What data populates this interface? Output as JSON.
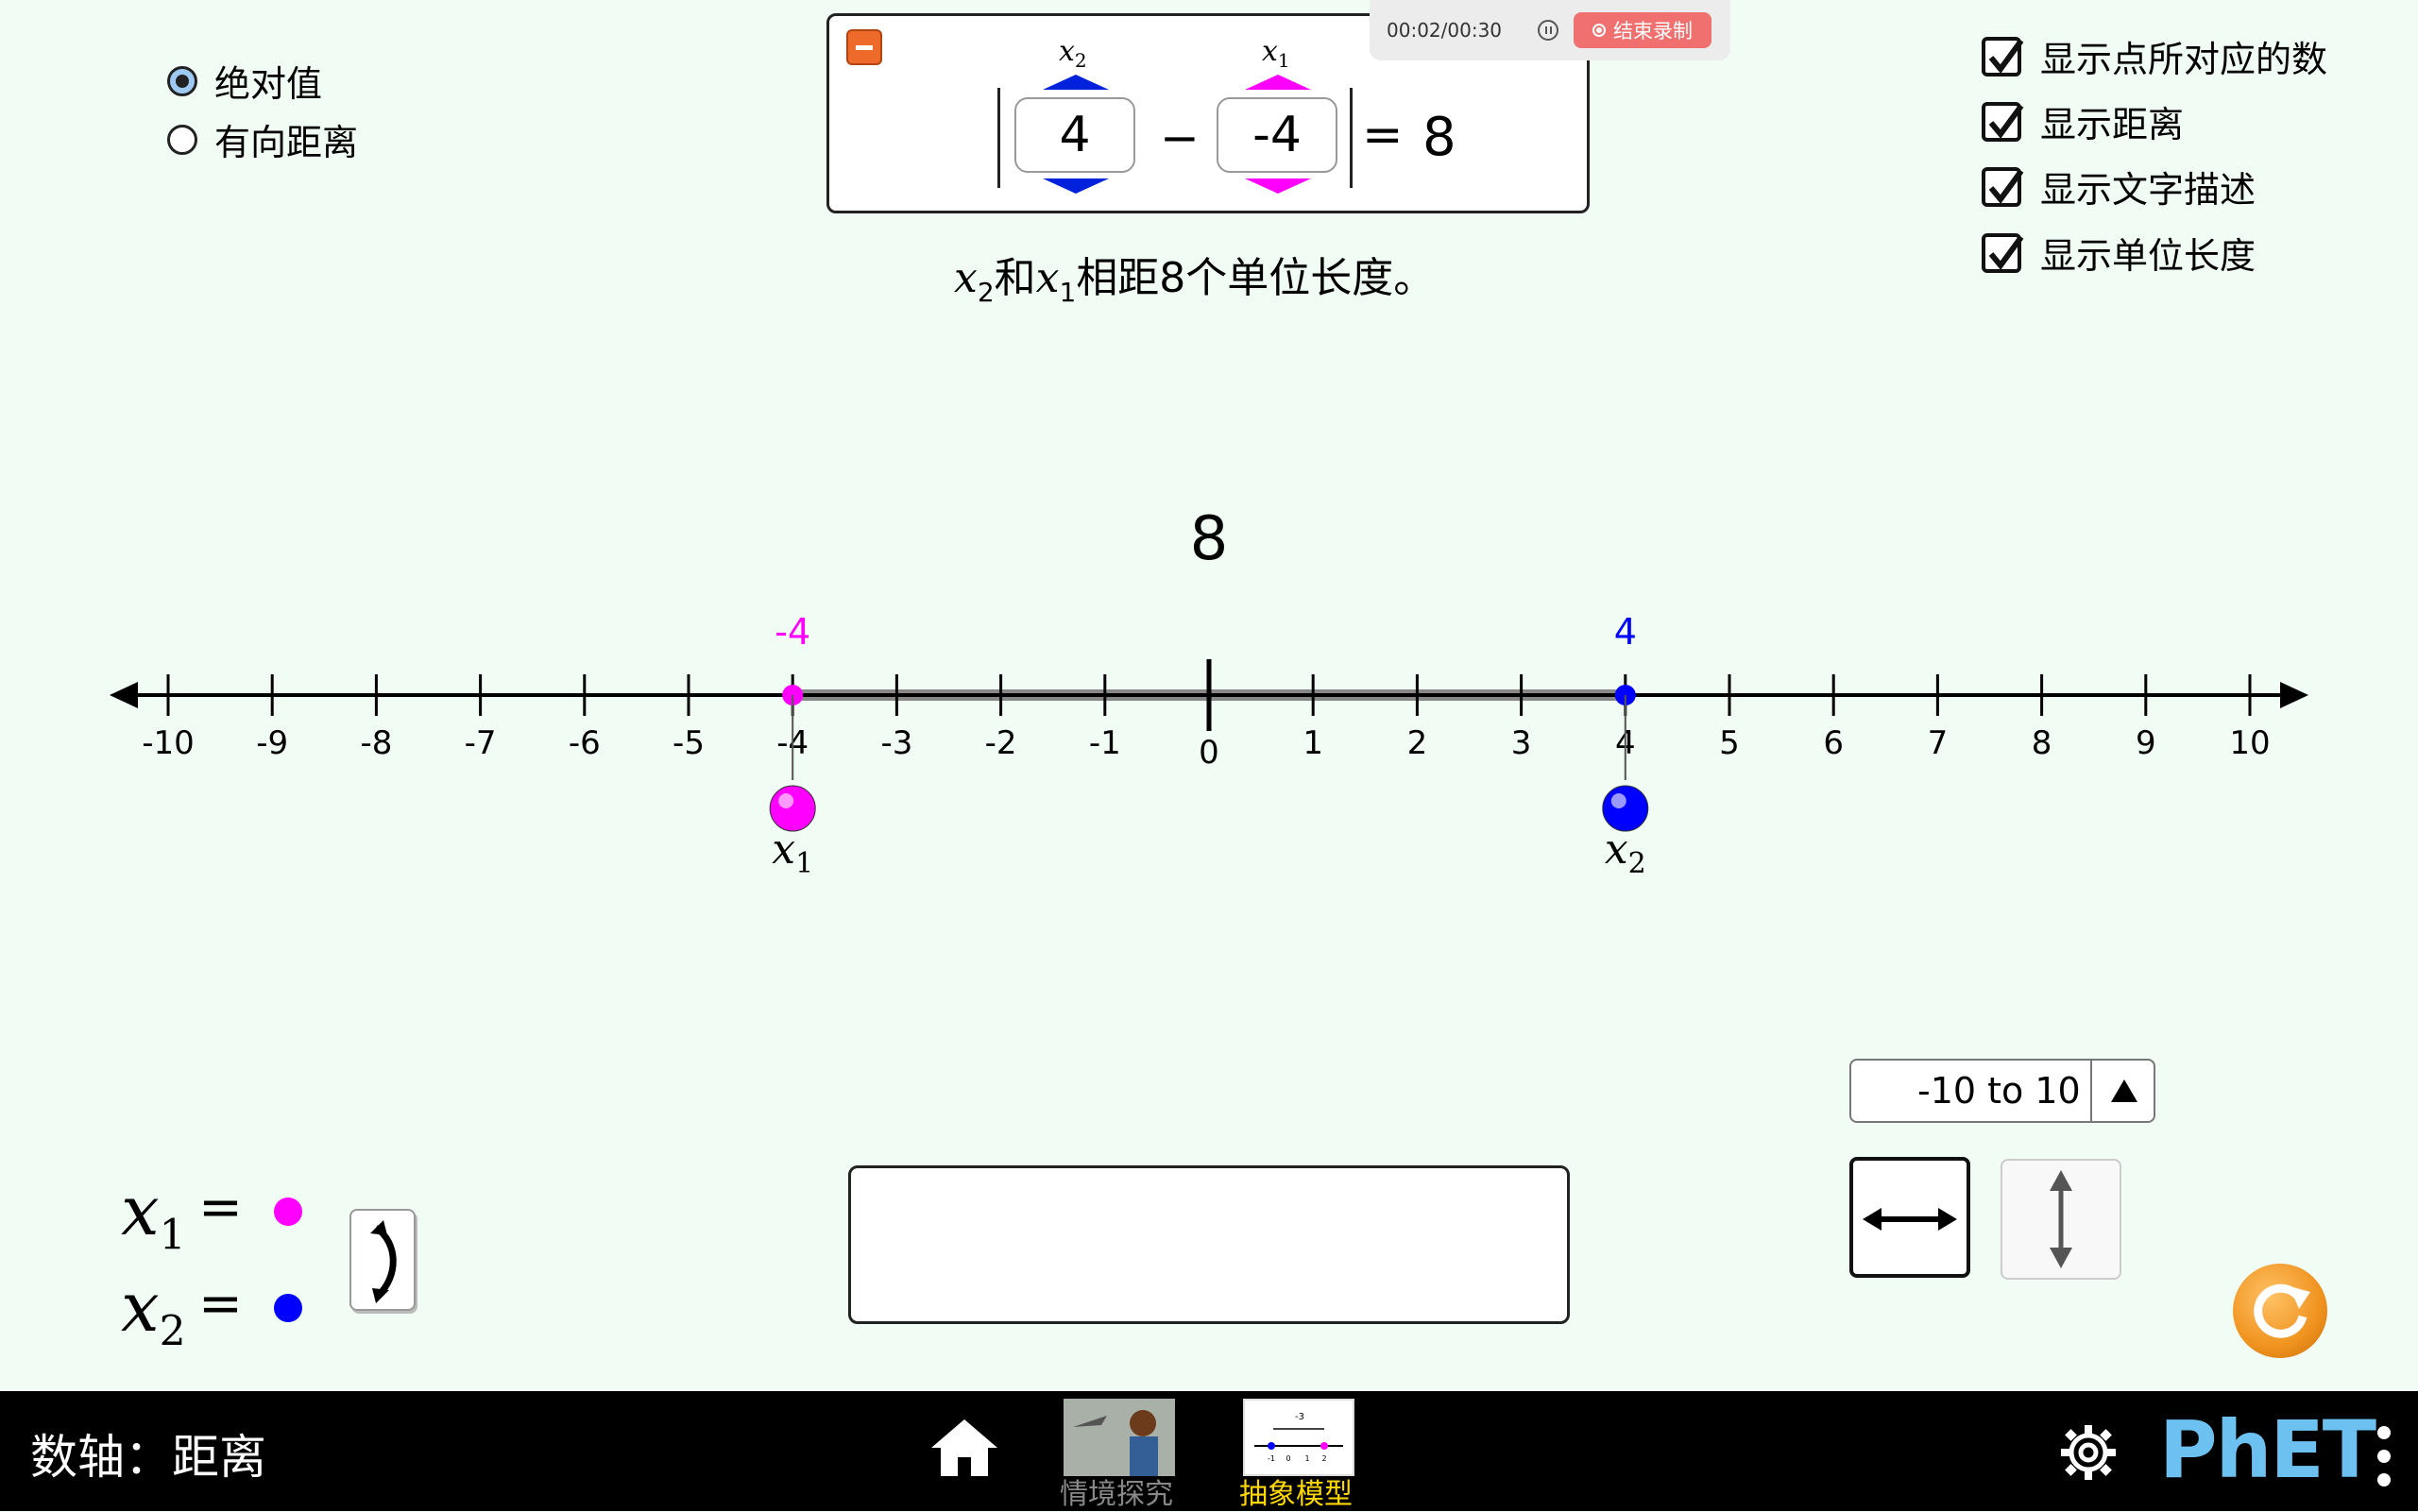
{
  "distance_mode": {
    "options": [
      {
        "label": "绝对值",
        "selected": true
      },
      {
        "label": "有向距离",
        "selected": false
      }
    ]
  },
  "checkboxes": [
    {
      "label": "显示点所对应的数",
      "checked": true
    },
    {
      "label": "显示距离",
      "checked": true
    },
    {
      "label": "显示文字描述",
      "checked": true
    },
    {
      "label": "显示单位长度",
      "checked": true
    }
  ],
  "recorder": {
    "time": "00:02/00:30",
    "stop_label": "结束录制"
  },
  "equation": {
    "x2_label": "x",
    "x2_sub": "2",
    "x1_label": "x",
    "x1_sub": "1",
    "x2_value": "4",
    "x1_value": "-4",
    "operator": "−",
    "equals": "=",
    "result": "8"
  },
  "description": {
    "a": "x",
    "a_sub": "2",
    "mid": "和",
    "b": "x",
    "b_sub": "1",
    "rest": "相距8个单位长度。"
  },
  "number_line": {
    "min": -10,
    "max": 10,
    "tick_labels": [
      "-10",
      "-9",
      "-8",
      "-7",
      "-6",
      "-5",
      "-4",
      "-3",
      "-2",
      "-1",
      "0",
      "1",
      "2",
      "3",
      "4",
      "5",
      "6",
      "7",
      "8",
      "9",
      "10"
    ],
    "distance_label": "8",
    "point_x1": {
      "value": -4,
      "label": "-4",
      "color": "#ff00ff",
      "name": "x",
      "sub": "1"
    },
    "point_x2": {
      "value": 4,
      "label": "4",
      "color": "#0000ff",
      "name": "x",
      "sub": "2"
    }
  },
  "legend": {
    "x1_name": "x",
    "x1_sub": "1",
    "x1_eq": "=",
    "x1_color": "#ff00ff",
    "x2_name": "x",
    "x2_sub": "2",
    "x2_eq": "=",
    "x2_color": "#0000ff"
  },
  "range_picker": {
    "value": "-10 to 10"
  },
  "nav": {
    "title": "数轴：距离",
    "screens": [
      {
        "label": "情境探究",
        "active": false
      },
      {
        "label": "抽象模型",
        "active": true
      }
    ],
    "brand": "PhET"
  },
  "colors": {
    "x1": "#ff00ff",
    "x2": "#0000ff",
    "background": "#f0fcf4",
    "active_nav": "#ffd700",
    "reset": "#f0931f"
  }
}
